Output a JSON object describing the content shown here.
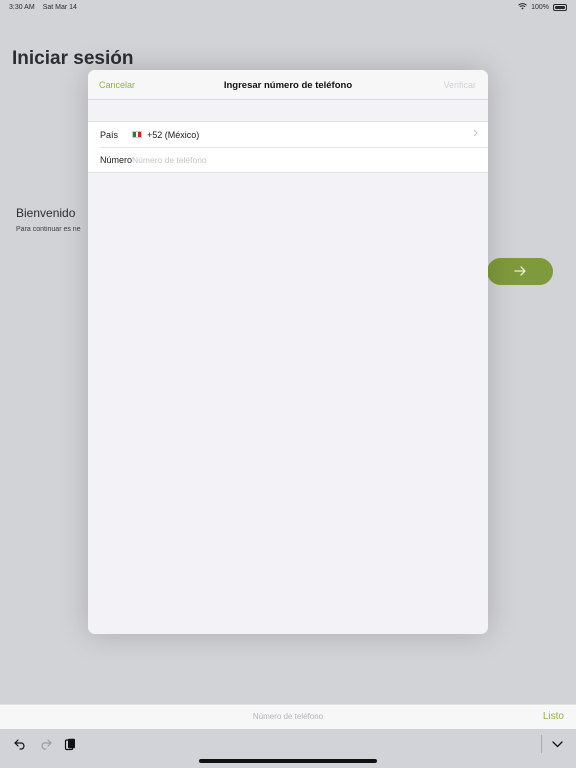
{
  "status_bar": {
    "time": "3:30 AM",
    "date": "Sat Mar 14",
    "battery": "100%"
  },
  "background": {
    "title": "Iniciar sesión",
    "welcome": "Bienvenido",
    "subtitle": "Para continuar es ne",
    "next_icon": "arrow-right-icon"
  },
  "sheet": {
    "nav": {
      "cancel_label": "Cancelar",
      "title": "Ingresar número de teléfono",
      "verify_label": "Verificar"
    },
    "rows": {
      "country_label": "País",
      "country_value": "+52 (México)",
      "number_label": "Número",
      "number_placeholder": "Número de teléfono"
    }
  },
  "keyboard_bar": {
    "field_placeholder": "Número de teléfono",
    "done_label": "Listo"
  },
  "colors": {
    "accent": "#8eb53e",
    "next_button": "#7f9a3c",
    "sheet_bg": "#f2f2f7",
    "dim_bg": "#d2d3d6"
  },
  "icons": {
    "undo": "undo-icon",
    "redo": "redo-icon",
    "paste": "clipboard-icon",
    "dismiss": "chevron-down-icon",
    "wifi": "wifi-icon",
    "battery": "battery-icon"
  }
}
